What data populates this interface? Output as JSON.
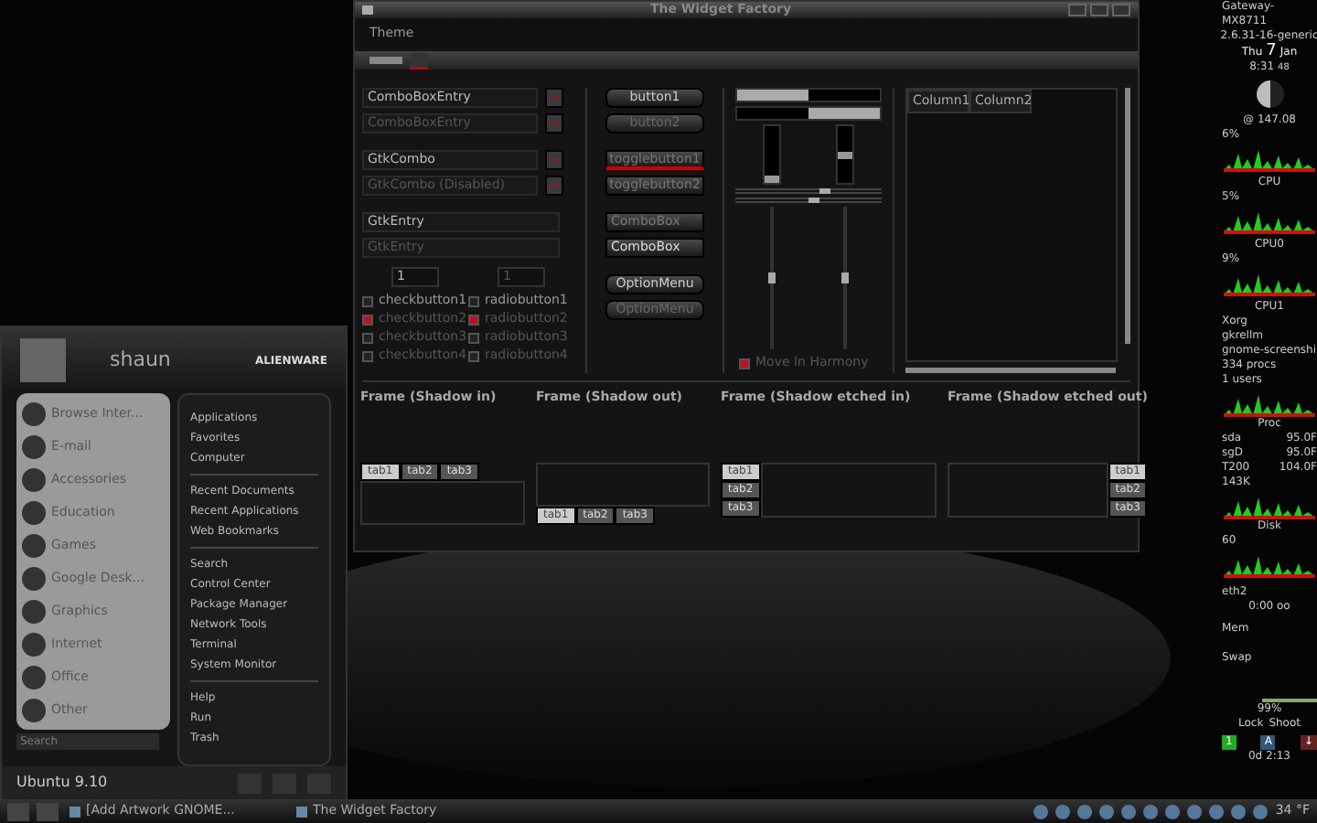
{
  "widget_factory": {
    "title": "The Widget Factory",
    "menu": [
      "Theme"
    ],
    "combo_entries": [
      {
        "value": "ComboBoxEntry",
        "disabled": false
      },
      {
        "value": "ComboBoxEntry",
        "disabled": true
      },
      {
        "value": "GtkCombo",
        "disabled": false
      },
      {
        "value": "GtkCombo (Disabled)",
        "disabled": true
      }
    ],
    "entries": [
      {
        "value": "GtkEntry",
        "disabled": false
      },
      {
        "value": "GtkEntry",
        "disabled": true
      }
    ],
    "spinners": [
      {
        "value": "1",
        "disabled": false
      },
      {
        "value": "1",
        "disabled": true
      }
    ],
    "checkbuttons": [
      {
        "label": "checkbutton1",
        "checked": false,
        "disabled": false
      },
      {
        "label": "checkbutton2",
        "checked": true,
        "disabled": true
      },
      {
        "label": "checkbutton3",
        "checked": false,
        "disabled": true
      },
      {
        "label": "checkbutton4",
        "checked": false,
        "disabled": true
      }
    ],
    "radiobuttons": [
      {
        "label": "radiobutton1",
        "checked": false,
        "disabled": false
      },
      {
        "label": "radiobutton2",
        "checked": true,
        "disabled": true
      },
      {
        "label": "radiobutton3",
        "checked": false,
        "disabled": true
      },
      {
        "label": "radiobutton4",
        "checked": false,
        "disabled": true
      }
    ],
    "buttons": [
      {
        "label": "button1",
        "disabled": false
      },
      {
        "label": "button2",
        "disabled": true
      }
    ],
    "toggle_buttons": [
      {
        "label": "togglebutton1",
        "checked": true
      },
      {
        "label": "togglebutton2",
        "checked": false
      }
    ],
    "combo_boxes": [
      {
        "value": "ComboBox",
        "disabled": true
      },
      {
        "value": "ComboBox",
        "disabled": false
      }
    ],
    "option_menus": [
      {
        "label": "OptionMenu",
        "disabled": false
      },
      {
        "label": "OptionMenu",
        "disabled": true
      }
    ],
    "progress_bars": [
      {
        "level": 0.5,
        "inverted": false
      },
      {
        "level": 0.5,
        "inverted": true
      }
    ],
    "horizontal_scales": [
      {
        "level": 0.57
      },
      {
        "level": 0.5
      }
    ],
    "vertical_scales": [
      {
        "level": 0.5
      },
      {
        "level": 0.5
      }
    ],
    "harmony": {
      "label": "Move In Harmony",
      "checked": true
    },
    "tree": {
      "columns": [
        "Column1",
        "Column2"
      ]
    },
    "frames": [
      {
        "label": "Frame (Shadow in)",
        "kind": "top",
        "tabs": [
          {
            "label": "tab1",
            "selected": true
          },
          {
            "label": "tab2",
            "selected": false
          },
          {
            "label": "tab3",
            "selected": false
          }
        ]
      },
      {
        "label": "Frame (Shadow out)",
        "kind": "bottom",
        "tabs": [
          {
            "label": "tab1",
            "selected": true
          },
          {
            "label": "tab2",
            "selected": false
          },
          {
            "label": "tab3",
            "selected": false
          }
        ]
      },
      {
        "label": "Frame (Shadow etched in)",
        "kind": "left",
        "tabs": [
          {
            "label": "tab1",
            "selected": true
          },
          {
            "label": "tab2",
            "selected": false
          },
          {
            "label": "tab3",
            "selected": false
          }
        ]
      },
      {
        "label": "Frame (Shadow etched out)",
        "kind": "right",
        "tabs": [
          {
            "label": "tab1",
            "selected": true
          },
          {
            "label": "tab2",
            "selected": false
          },
          {
            "label": "tab3",
            "selected": false
          }
        ]
      }
    ]
  },
  "menu": {
    "user": "shaun",
    "brand": "ALIENWARE",
    "categories": [
      "Browse Inter...",
      "E-mail",
      "Accessories",
      "Education",
      "Games",
      "Google Desk...",
      "Graphics",
      "Internet",
      "Office",
      "Other"
    ],
    "search": {
      "placeholder": "Search"
    },
    "link_groups": [
      [
        "Applications",
        "Favorites",
        "Computer"
      ],
      [
        "Recent Documents",
        "Recent Applications",
        "Web Bookmarks"
      ],
      [
        "Search",
        "Control Center",
        "Package Manager",
        "Network Tools",
        "Terminal",
        "System Monitor"
      ],
      [
        "Help",
        "Run",
        "Trash"
      ]
    ],
    "os": "Ubuntu 9.10"
  },
  "conky": {
    "host": "Gateway-MX8711",
    "kernel": "2.6.31-16-generic",
    "day": "Thu",
    "date": "7",
    "month": "Jan",
    "time": "8:31",
    "seconds": "48",
    "load": "@ 147.08",
    "cpu_graphs": [
      {
        "value": "6%",
        "label": "CPU"
      },
      {
        "value": "5%",
        "label": "CPU0"
      },
      {
        "value": "9%",
        "label": "CPU1"
      }
    ],
    "processes": [
      "Xorg",
      "gkrellm",
      "gnome-screenshi"
    ],
    "procs": "334 procs",
    "users": "1 users",
    "proc_label": "Proc",
    "sensors": [
      {
        "name": "sda",
        "value": "95.0F"
      },
      {
        "name": "sgD",
        "value": "95.0F"
      },
      {
        "name": "T200",
        "value": "104.0F"
      }
    ],
    "disk_rate": "143K",
    "disk_label": "Disk",
    "disk_scale": "60",
    "net": "eth2",
    "net_time": "0:00 oo",
    "mem": "Mem",
    "swap": "Swap",
    "battery": "99%",
    "lock": "Lock",
    "shoot": "Shoot",
    "indicators": [
      {
        "label": "1",
        "color": "#22aa22"
      },
      {
        "label": "A",
        "color": "#335577"
      },
      {
        "label": "↓",
        "color": "#662222"
      }
    ],
    "uptime": "0d 2:13"
  },
  "taskbar": {
    "tasks": [
      "[Add Artwork GNOME...",
      "The Widget Factory"
    ],
    "temperature": "34 °F"
  }
}
